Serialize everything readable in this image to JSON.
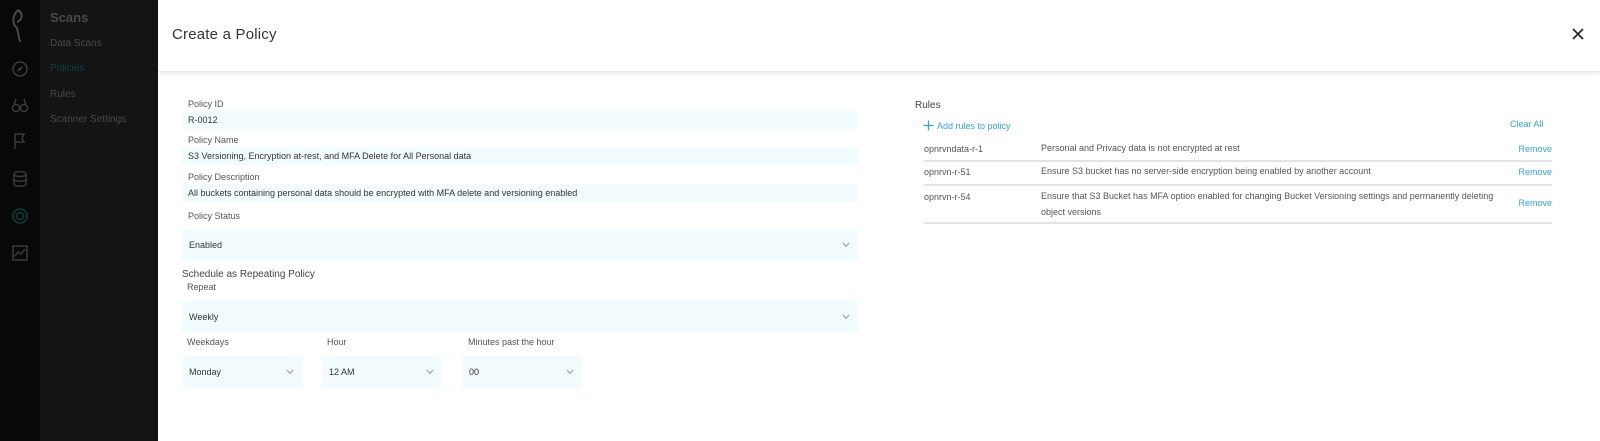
{
  "background_app": {
    "section_title": "Scans",
    "nav_items": [
      {
        "label": "Data Scans",
        "active": false
      },
      {
        "label": "Policies",
        "active": true
      },
      {
        "label": "Rules",
        "active": false
      },
      {
        "label": "Scanner Settings",
        "active": false
      }
    ],
    "rail_icons": [
      "compass-icon",
      "binoculars-icon",
      "flag-icon",
      "database-icon",
      "target-icon",
      "chart-icon"
    ]
  },
  "modal": {
    "title": "Create a Policy",
    "close_icon": "close-icon"
  },
  "form": {
    "policy_id_label": "Policy ID",
    "policy_id_value": "R-0012",
    "policy_name_label": "Policy Name",
    "policy_name_value": "S3 Versioning, Encryption at-rest, and MFA Delete for All Personal data",
    "policy_description_label": "Policy Description",
    "policy_description_value": "All buckets containing personal data should be encrypted with MFA delete and versioning enabled",
    "policy_status_label": "Policy Status",
    "policy_status_value": "Enabled",
    "schedule_title": "Schedule as Repeating Policy",
    "repeat_label": "Repeat",
    "repeat_value": "Weekly",
    "weekdays_label": "Weekdays",
    "weekdays_value": "Monday",
    "hour_label": "Hour",
    "hour_value": "12 AM",
    "minutes_label": "Minutes past the hour",
    "minutes_value": "00"
  },
  "rules": {
    "title": "Rules",
    "add_label": "Add rules to policy",
    "clear_all_label": "Clear All",
    "items": [
      {
        "id": "opnrvndata-r-1",
        "description": "Personal and Privacy data is not encrypted at rest",
        "remove_label": "Remove"
      },
      {
        "id": "opnrvn-r-51",
        "description": "Ensure S3 bucket has no server-side encryption being enabled by another account",
        "remove_label": "Remove"
      },
      {
        "id": "opnrvn-r-54",
        "description": "Ensure that S3 Bucket has MFA option enabled for changing Bucket Versioning settings and permanently deleting object versions",
        "remove_label": "Remove"
      }
    ]
  },
  "colors": {
    "accent": "#3aa0d8",
    "field_bg": "#f2fbfd",
    "sidebar_bg": "#141414",
    "rail_bg": "#080808"
  }
}
